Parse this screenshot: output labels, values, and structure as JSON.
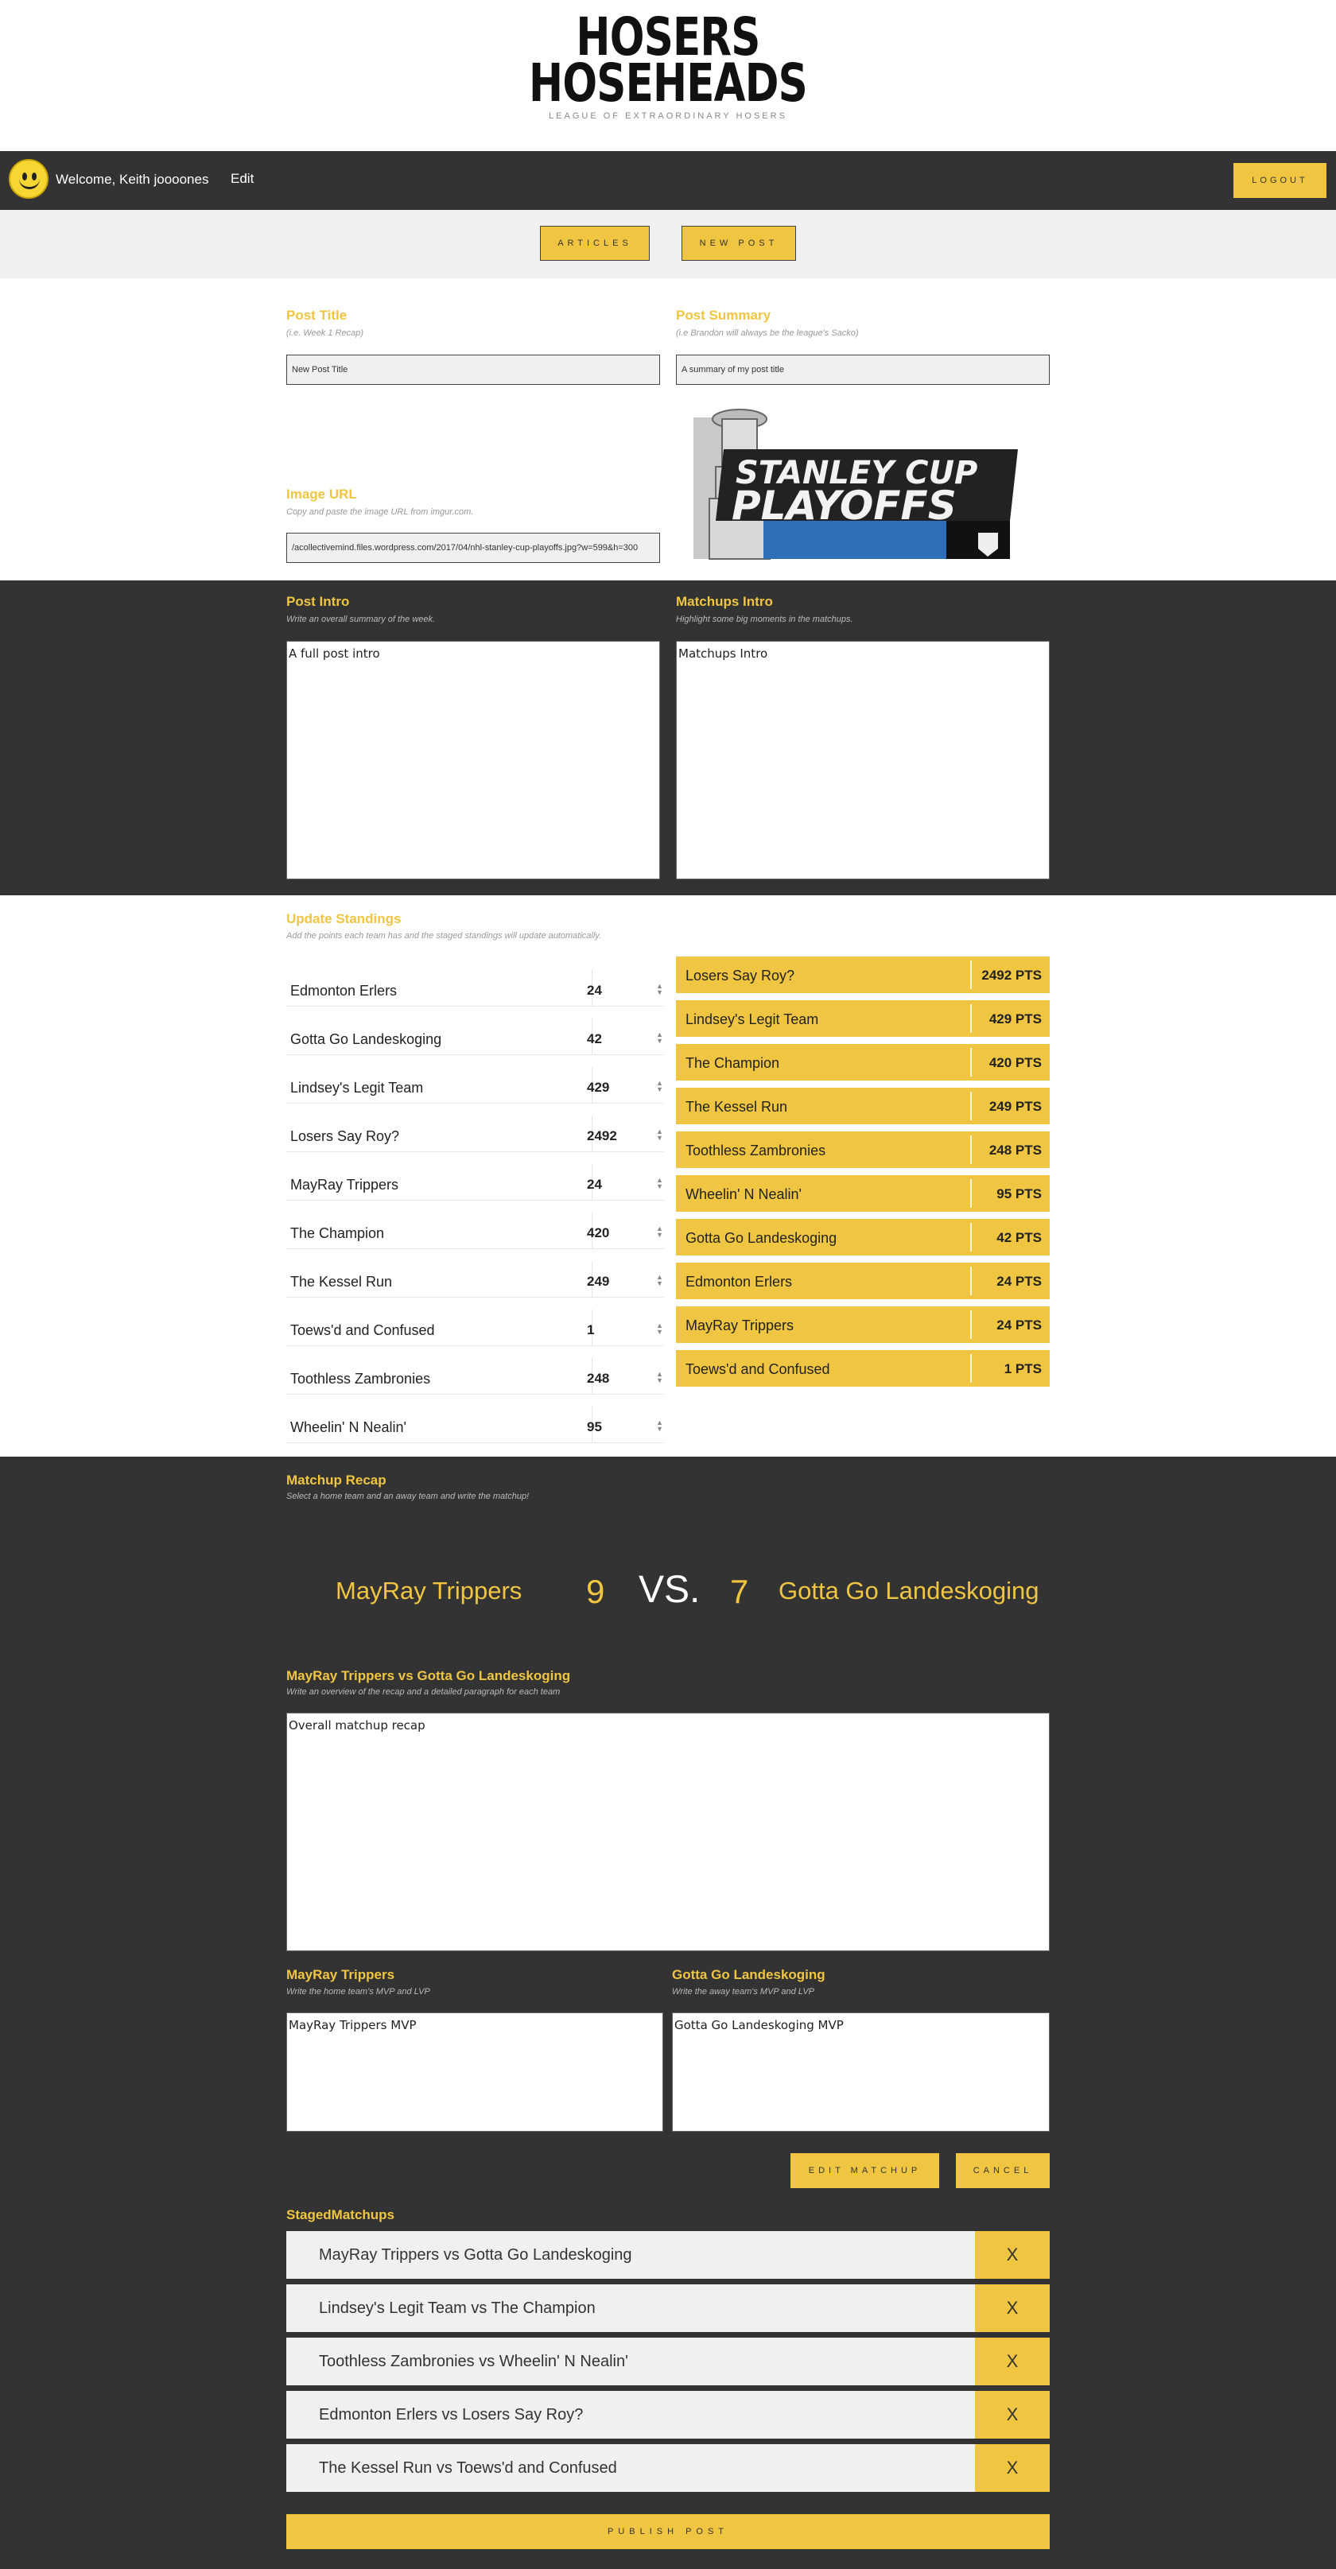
{
  "brand": {
    "line1": "HOSERS",
    "line2": "HOSEHEADS",
    "tagline": "LEAGUE OF EXTRAORDINARY HOSERS"
  },
  "nav": {
    "welcome": "Welcome, Keith joooones",
    "edit": "Edit",
    "logout": "LOGOUT"
  },
  "toolbar": {
    "articles": "ARTICLES",
    "new_post": "NEW POST"
  },
  "post": {
    "title_label": "Post Title",
    "title_hint": "(i.e. Week 1 Recap)",
    "title_value": "New Post Title",
    "summary_label": "Post Summary",
    "summary_hint": "(i.e Brandon will always be the league's Sacko)",
    "summary_value": "A summary of my post title",
    "image_label": "Image URL",
    "image_hint": "Copy and paste the image URL from imgur.com.",
    "image_value": "/acollectivemind.files.wordpress.com/2017/04/nhl-stanley-cup-playoffs.jpg?w=599&h=300",
    "image_text_top": "STANLEY CUP",
    "image_text_bottom": "PLAYOFFS",
    "intro_label": "Post Intro",
    "intro_hint": "Write an overall summary of the week.",
    "intro_value": "A full post intro",
    "matchups_label": "Matchups Intro",
    "matchups_hint": "Highlight some big moments in the matchups.",
    "matchups_value": "Matchups Intro"
  },
  "standings": {
    "label": "Update Standings",
    "hint": "Add the points each team has and the staged standings will update automatically.",
    "inputs": [
      {
        "team": "Edmonton Erlers",
        "points": "24"
      },
      {
        "team": "Gotta Go Landeskoging",
        "points": "42"
      },
      {
        "team": "Lindsey's Legit Team",
        "points": "429"
      },
      {
        "team": "Losers Say Roy?",
        "points": "2492"
      },
      {
        "team": "MayRay Trippers",
        "points": "24"
      },
      {
        "team": "The Champion",
        "points": "420"
      },
      {
        "team": "The Kessel Run",
        "points": "249"
      },
      {
        "team": "Toews'd and Confused",
        "points": "1"
      },
      {
        "team": "Toothless Zambronies",
        "points": "248"
      },
      {
        "team": "Wheelin' N Nealin'",
        "points": "95"
      }
    ],
    "ranked": [
      {
        "team": "Losers Say Roy?",
        "pts": "2492 PTS"
      },
      {
        "team": "Lindsey's Legit Team",
        "pts": "429 PTS"
      },
      {
        "team": "The Champion",
        "pts": "420 PTS"
      },
      {
        "team": "The Kessel Run",
        "pts": "249 PTS"
      },
      {
        "team": "Toothless Zambronies",
        "pts": "248 PTS"
      },
      {
        "team": "Wheelin' N Nealin'",
        "pts": "95 PTS"
      },
      {
        "team": "Gotta Go Landeskoging",
        "pts": "42 PTS"
      },
      {
        "team": "Edmonton Erlers",
        "pts": "24 PTS"
      },
      {
        "team": "MayRay Trippers",
        "pts": "24 PTS"
      },
      {
        "team": "Toews'd and Confused",
        "pts": "1 PTS"
      }
    ]
  },
  "matchup": {
    "label": "Matchup Recap",
    "hint": "Select a home team and an away team and write the matchup!",
    "home_team": "MayRay Trippers",
    "home_score": "9",
    "vs": "VS.",
    "away_score": "7",
    "away_team": "Gotta Go Landeskoging",
    "recap_label": "MayRay Trippers vs Gotta Go Landeskoging",
    "recap_hint": "Write an overview of the recap and a detailed paragraph for each team",
    "recap_value": "Overall matchup recap",
    "home_label": "MayRay Trippers",
    "home_hint": "Write the home team's MVP and LVP",
    "home_value": "MayRay Trippers MVP",
    "away_label": "Gotta Go Landeskoging",
    "away_hint": "Write the away team's MVP and LVP",
    "away_value": "Gotta Go Landeskoging MVP",
    "edit_btn": "EDIT MATCHUP",
    "cancel_btn": "CANCEL"
  },
  "staged": {
    "label": "StagedMatchups",
    "remove": "X",
    "items": [
      "MayRay Trippers vs Gotta Go Landeskoging",
      "Lindsey's Legit Team vs The Champion",
      "Toothless Zambronies vs Wheelin' N Nealin'",
      "Edmonton Erlers vs Losers Say Roy?",
      "The Kessel Run vs Toews'd and Confused"
    ]
  },
  "publish": "PUBLISH POST",
  "colors": {
    "accent": "#f0c541",
    "dark": "#333333",
    "light": "#f0f0f0"
  }
}
